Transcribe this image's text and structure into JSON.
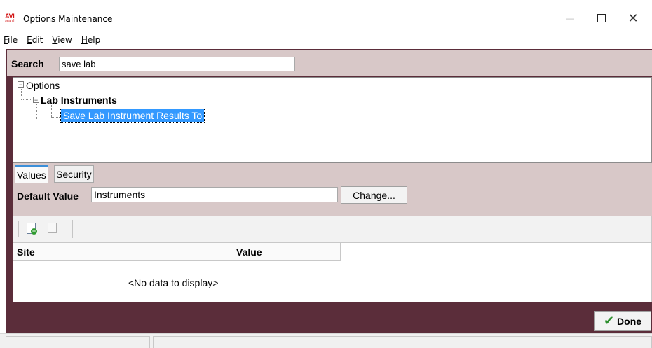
{
  "window": {
    "logo_text": "AVI",
    "logo_sub": "search",
    "title": "Options Maintenance",
    "minimize_glyph": "—",
    "close_glyph": "✕"
  },
  "menu": [
    "File",
    "Edit",
    "View",
    "Help"
  ],
  "search": {
    "label": "Search",
    "value": "save lab"
  },
  "tree": {
    "root": "Options",
    "root_expander": "−",
    "group": "Lab Instruments",
    "group_expander": "−",
    "selected_item": "Save Lab Instrument Results To"
  },
  "tabs": [
    {
      "label": "Values",
      "active": true
    },
    {
      "label": "Security",
      "active": false
    }
  ],
  "values": {
    "default_label": "Default Value",
    "default_value": "Instruments",
    "change_label": "Change..."
  },
  "toolbar": {
    "add_icon": "add-record-icon",
    "edit_icon": "edit-record-icon"
  },
  "grid": {
    "columns": [
      "Site",
      "Value"
    ],
    "empty_message": "<No data to display>"
  },
  "done": {
    "label": "Done",
    "icon": "✔"
  },
  "colors": {
    "panel": "#5b2d3a",
    "panel_light": "#d8c8c8",
    "selection": "#3399ff",
    "done_check": "#2d8f2d"
  }
}
